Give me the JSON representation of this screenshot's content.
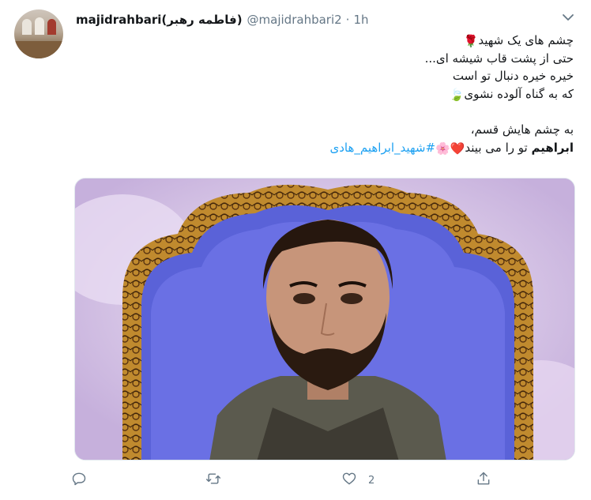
{
  "tweet": {
    "display_name": "majidrahbari(فاطمه رهبر)",
    "handle": "@majidrahbari2",
    "separator": "·",
    "time": "1h",
    "lines": [
      "چشم های یک شهید",
      "حتی از پشت قاب شیشه ای...",
      "خیره خیره دنبال تو است",
      "که به گناه آلوده نشوی",
      "به چشم هایش قسم،"
    ],
    "last_line_bold": "ابراهیم",
    "last_line_text": "تو را می بیند",
    "hashtag": "#شهید_ابراهیم_هادی",
    "emoji": {
      "rose": "🌹",
      "leaf": "🍃",
      "heart": "❤️",
      "blossom": "🌸"
    },
    "image_alt": "portrait",
    "likes_count": "2"
  },
  "icons": {
    "reply": "reply-icon",
    "retweet": "retweet-icon",
    "like": "heart-icon",
    "share": "share-icon",
    "menu": "chevron-down-icon"
  },
  "colors": {
    "link": "#1da1f2",
    "muted": "#657786",
    "text": "#14171a"
  }
}
